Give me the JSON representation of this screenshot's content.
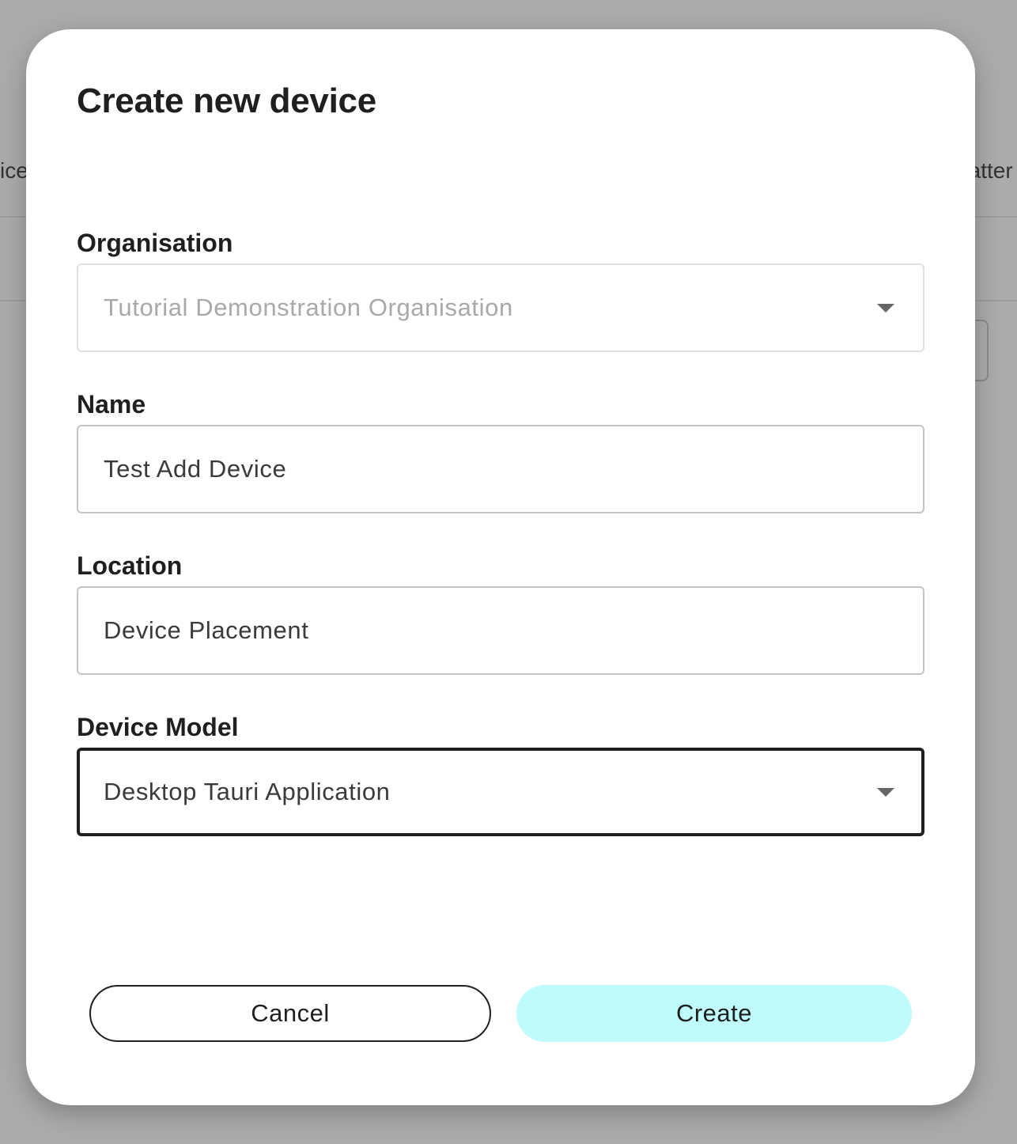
{
  "background": {
    "left_fragment": "vice",
    "right_fragment": "Batter"
  },
  "dialog": {
    "title": "Create new device",
    "fields": {
      "organisation": {
        "label": "Organisation",
        "value": "Tutorial Demonstration Organisation",
        "disabled": true,
        "type": "select"
      },
      "name": {
        "label": "Name",
        "value": "Test Add Device",
        "type": "text"
      },
      "location": {
        "label": "Location",
        "value": "Device Placement",
        "type": "text"
      },
      "device_model": {
        "label": "Device Model",
        "value": "Desktop Tauri Application",
        "focused": true,
        "type": "select"
      }
    },
    "actions": {
      "cancel_label": "Cancel",
      "create_label": "Create"
    }
  },
  "colors": {
    "create_button": "#c0fbfb",
    "backdrop": "#ababab",
    "text": "#1f1f1f"
  },
  "icons": {
    "dropdown": "chevron-down-icon"
  }
}
